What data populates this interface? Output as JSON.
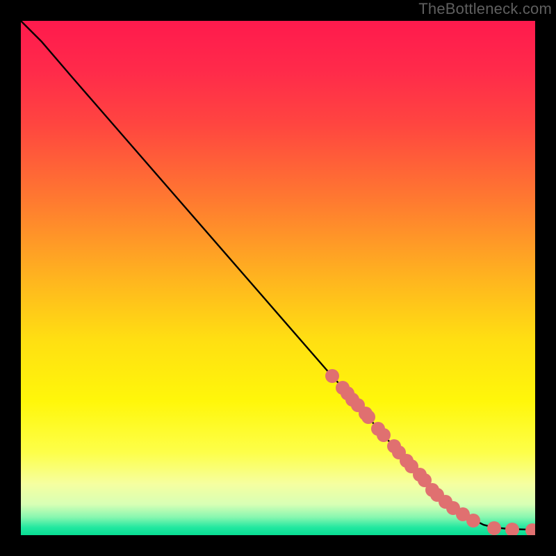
{
  "attribution": "TheBottleneck.com",
  "colors": {
    "marker": "#e07070",
    "curve": "#000000",
    "background_black": "#000000"
  },
  "chart_data": {
    "type": "line",
    "title": "",
    "xlabel": "",
    "ylabel": "",
    "xlim": [
      0,
      100
    ],
    "ylim": [
      0,
      100
    ],
    "curve": {
      "x": [
        0,
        4,
        10,
        20,
        30,
        40,
        50,
        60,
        65,
        70,
        75,
        80,
        85,
        90,
        92,
        95,
        98,
        100
      ],
      "y": [
        100,
        96,
        89,
        77.5,
        66,
        54.5,
        43,
        31.5,
        26,
        20,
        14.5,
        9,
        4.5,
        2,
        1.5,
        1.2,
        1.1,
        1.0
      ]
    },
    "markers": {
      "x": [
        60.5,
        62.5,
        63.5,
        64.5,
        65.5,
        67.0,
        67.5,
        69.5,
        70.5,
        72.5,
        73.5,
        75.0,
        76.0,
        77.5,
        78.5,
        80.0,
        81.0,
        82.5,
        84.0,
        86.0,
        88.0,
        92.0,
        95.5,
        99.5
      ],
      "y": [
        31.0,
        28.7,
        27.6,
        26.4,
        25.3,
        23.7,
        23.0,
        20.7,
        19.4,
        17.3,
        16.1,
        14.5,
        13.4,
        11.8,
        10.7,
        8.8,
        7.8,
        6.5,
        5.3,
        4.0,
        2.8,
        1.4,
        1.1,
        1.0
      ]
    },
    "gradient_stops": [
      {
        "pos": 0.0,
        "color": "#ff1a4d"
      },
      {
        "pos": 0.1,
        "color": "#ff2b4a"
      },
      {
        "pos": 0.2,
        "color": "#ff4540"
      },
      {
        "pos": 0.35,
        "color": "#ff7a30"
      },
      {
        "pos": 0.5,
        "color": "#ffb41f"
      },
      {
        "pos": 0.62,
        "color": "#ffdf12"
      },
      {
        "pos": 0.74,
        "color": "#fff70a"
      },
      {
        "pos": 0.84,
        "color": "#fdff4a"
      },
      {
        "pos": 0.9,
        "color": "#f6ffa0"
      },
      {
        "pos": 0.94,
        "color": "#d8ffb5"
      },
      {
        "pos": 0.965,
        "color": "#88f7b0"
      },
      {
        "pos": 0.985,
        "color": "#22e8a0"
      },
      {
        "pos": 1.0,
        "color": "#08dd92"
      }
    ]
  }
}
